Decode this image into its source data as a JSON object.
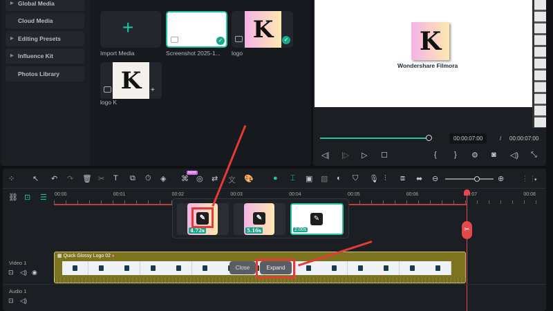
{
  "sidebar": {
    "items": [
      {
        "label": "Global Media",
        "expandable": true
      },
      {
        "label": "Cloud Media",
        "expandable": false
      },
      {
        "label": "Editing Presets",
        "expandable": true
      },
      {
        "label": "Influence Kit",
        "expandable": true
      },
      {
        "label": "Photos Library",
        "expandable": false
      }
    ]
  },
  "media": {
    "items": [
      {
        "label": "Import Media"
      },
      {
        "label": "Screenshot 2025-1...",
        "selected": true
      },
      {
        "label": "logo",
        "selected": true
      },
      {
        "label": "logo K"
      }
    ],
    "logo_letter": "K"
  },
  "preview": {
    "brand_text": "Wondershare Filmora",
    "current_time": "00:00:07:00",
    "separator": "/",
    "total_time": "00:00:07:00",
    "progress": 1.0
  },
  "timeline": {
    "ruler": [
      "00:00",
      "00:01",
      "00:02",
      "00:03",
      "00:04",
      "00:05",
      "00:06",
      "00:07",
      "00:08"
    ],
    "thumbnails": [
      {
        "duration": "4.72s"
      },
      {
        "duration": "5.16s"
      },
      {
        "duration": "2.00s"
      }
    ],
    "clip_title": "Quick Glossy Logo 02",
    "close_label": "Close",
    "expand_label": "Expand",
    "tracks": [
      {
        "label": "Video 1"
      },
      {
        "label": "Audio 1"
      }
    ],
    "badge": "NEW"
  },
  "colors": {
    "accent": "#1fc7a4",
    "playhead": "#e8474a",
    "annotation": "#e53a35",
    "clip": "#7d7420"
  }
}
